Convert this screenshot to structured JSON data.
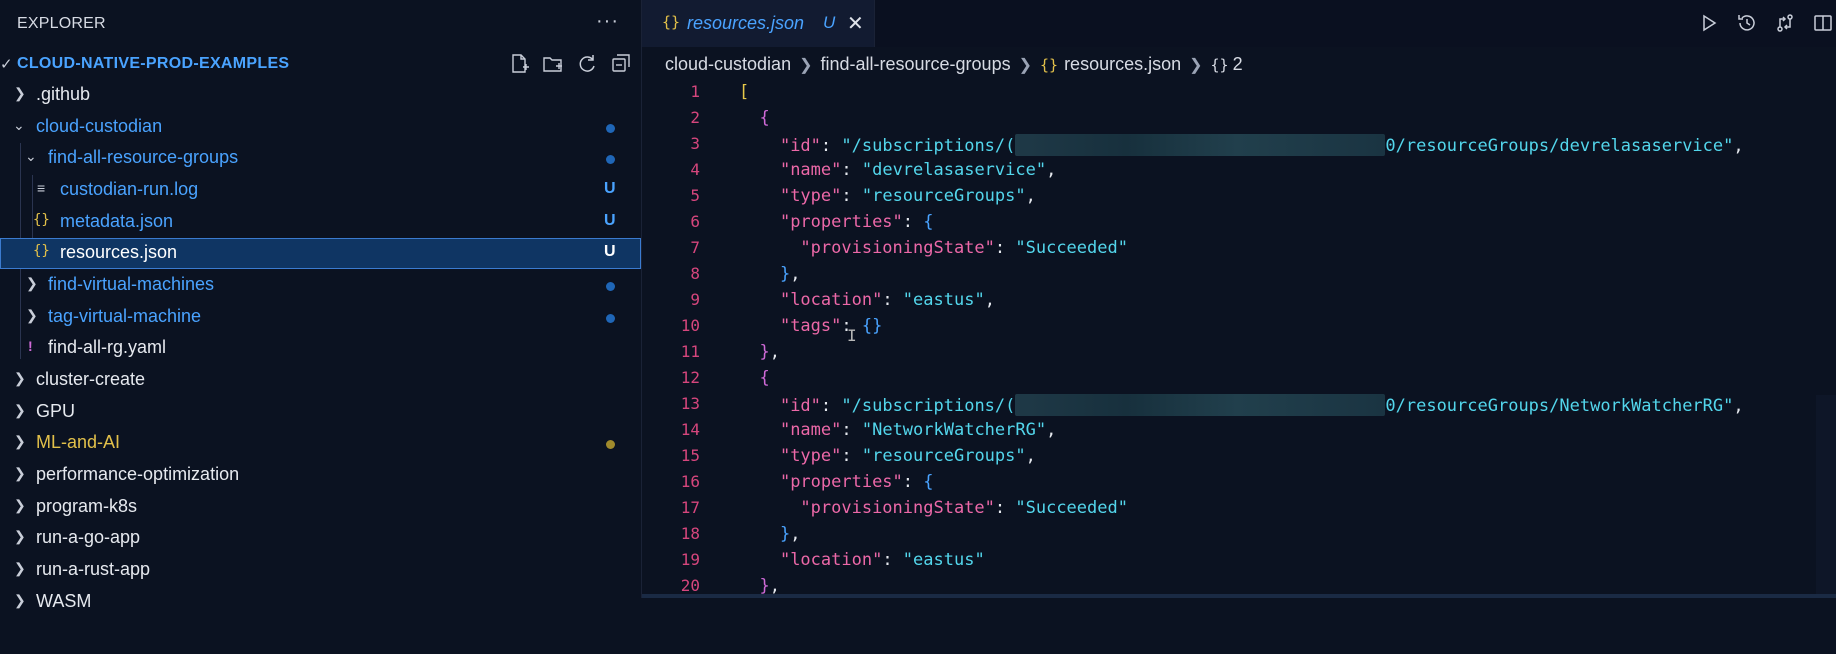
{
  "explorer": {
    "title": "EXPLORER",
    "more": "···",
    "workspace_folder": "CLOUD-NATIVE-PROD-EXAMPLES",
    "items": [
      {
        "label": ".github",
        "badge": "",
        "kind": "folder",
        "expanded": false,
        "color": "#e6e9ef"
      },
      {
        "label": "cloud-custodian",
        "badge": "",
        "kind": "folder",
        "expanded": true,
        "color": "#4aa3ff"
      },
      {
        "label": "find-all-resource-groups",
        "badge": "",
        "kind": "folder",
        "expanded": true,
        "color": "#4aa3ff"
      },
      {
        "label": "custodian-run.log",
        "badge": "U",
        "kind": "file-log",
        "color": "#4aa3ff"
      },
      {
        "label": "metadata.json",
        "badge": "U",
        "kind": "file-json",
        "color": "#4aa3ff"
      },
      {
        "label": "resources.json",
        "badge": "U",
        "kind": "file-json",
        "color": "#ffffff"
      },
      {
        "label": "find-virtual-machines",
        "badge": "",
        "kind": "folder",
        "expanded": false,
        "color": "#4aa3ff"
      },
      {
        "label": "tag-virtual-machine",
        "badge": "",
        "kind": "folder",
        "expanded": false,
        "color": "#4aa3ff"
      },
      {
        "label": "find-all-rg.yaml",
        "badge": "",
        "kind": "file-yaml",
        "color": "#e6e9ef"
      },
      {
        "label": "cluster-create",
        "badge": "",
        "kind": "folder",
        "expanded": false,
        "color": "#e6e9ef"
      },
      {
        "label": "GPU",
        "badge": "",
        "kind": "folder",
        "expanded": false,
        "color": "#e6e9ef"
      },
      {
        "label": "ML-and-AI",
        "badge": "",
        "kind": "folder",
        "expanded": false,
        "color": "#e2c04a"
      },
      {
        "label": "performance-optimization",
        "badge": "",
        "kind": "folder",
        "expanded": false,
        "color": "#e6e9ef"
      },
      {
        "label": "program-k8s",
        "badge": "",
        "kind": "folder",
        "expanded": false,
        "color": "#e6e9ef"
      },
      {
        "label": "run-a-go-app",
        "badge": "",
        "kind": "folder",
        "expanded": false,
        "color": "#e6e9ef"
      },
      {
        "label": "run-a-rust-app",
        "badge": "",
        "kind": "folder",
        "expanded": false,
        "color": "#e6e9ef"
      },
      {
        "label": "WASM",
        "badge": "",
        "kind": "folder",
        "expanded": false,
        "color": "#e6e9ef"
      }
    ]
  },
  "tab": {
    "icon": "{}",
    "label": "resources.json",
    "badge": "U",
    "close": "✕"
  },
  "breadcrumb": {
    "parts": [
      "cloud-custodian",
      "find-all-resource-groups",
      "resources.json",
      "2"
    ],
    "file_icon": "{}",
    "node_icon": "{}"
  },
  "code": {
    "line_numbers": [
      "1",
      "2",
      "3",
      "4",
      "5",
      "6",
      "7",
      "8",
      "9",
      "10",
      "11",
      "12",
      "13",
      "14",
      "15",
      "16",
      "17",
      "18",
      "19",
      "20"
    ],
    "l3_id_prefix": "\"/subscriptions/(",
    "l3_id_suffix": "0/resourceGroups/devrelasaservice\"",
    "l4_name": "\"devrelasaservice\"",
    "l5_type": "\"resourceGroups\"",
    "l7_state": "\"Succeeded\"",
    "l9_location": "\"eastus\"",
    "l13_id_prefix": "\"/subscriptions/(",
    "l13_id_suffix": "0/resourceGroups/NetworkWatcherRG\"",
    "l14_name": "\"NetworkWatcherRG\"",
    "l15_type": "\"resourceGroups\"",
    "l17_state": "\"Succeeded\"",
    "l19_location": "\"eastus\"",
    "keys": {
      "id": "\"id\"",
      "name": "\"name\"",
      "type": "\"type\"",
      "properties": "\"properties\"",
      "provisioningState": "\"provisioningState\"",
      "location": "\"location\"",
      "tags": "\"tags\""
    }
  }
}
